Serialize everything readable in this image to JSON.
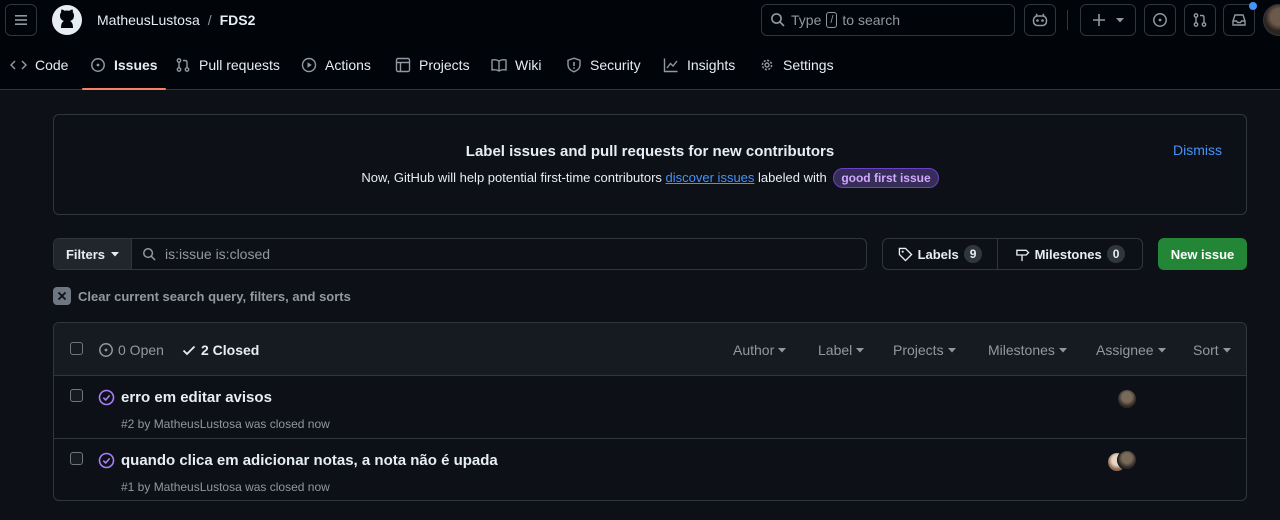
{
  "topbar": {
    "owner": "MatheusLustosa",
    "separator": "/",
    "repo": "FDS2",
    "search_prefix": "Type",
    "search_key": "/",
    "search_suffix": "to search"
  },
  "tabs": [
    {
      "label": "Code",
      "icon": "code-icon"
    },
    {
      "label": "Issues",
      "icon": "issue-opened-icon",
      "selected": true
    },
    {
      "label": "Pull requests",
      "icon": "git-pull-request-icon"
    },
    {
      "label": "Actions",
      "icon": "play-icon"
    },
    {
      "label": "Projects",
      "icon": "table-icon"
    },
    {
      "label": "Wiki",
      "icon": "book-icon"
    },
    {
      "label": "Security",
      "icon": "shield-icon"
    },
    {
      "label": "Insights",
      "icon": "graph-icon"
    },
    {
      "label": "Settings",
      "icon": "gear-icon"
    }
  ],
  "banner": {
    "title": "Label issues and pull requests for new contributors",
    "text_before": "Now, GitHub will help potential first-time contributors",
    "link": "discover issues",
    "text_after": "labeled with",
    "label": "good first issue",
    "dismiss": "Dismiss"
  },
  "filters": {
    "button": "Filters",
    "query": "is:issue is:closed",
    "labels": "Labels",
    "labels_count": "9",
    "milestones": "Milestones",
    "milestones_count": "0",
    "new_issue": "New issue",
    "clear": "Clear current search query, filters, and sorts"
  },
  "list": {
    "open": "0 Open",
    "closed": "2 Closed",
    "author": "Author",
    "label": "Label",
    "projects": "Projects",
    "milestones": "Milestones",
    "assignee": "Assignee",
    "sort": "Sort",
    "issues": [
      {
        "title": "erro em editar avisos",
        "meta": "#2 by MatheusLustosa was closed now"
      },
      {
        "title": "quando clica em adicionar notas, a nota não é upada",
        "meta": "#1 by MatheusLustosa was closed now"
      }
    ]
  },
  "colors": {
    "accent_underline": "#f78166",
    "link": "#4493f8",
    "closed_issue": "#ab7df8",
    "new_issue_button": "#238636"
  }
}
